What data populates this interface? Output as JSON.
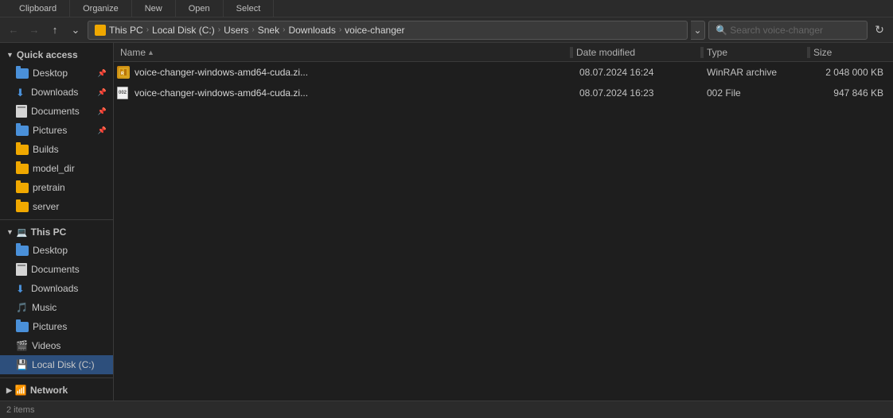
{
  "toolbar": {
    "sections": [
      "Clipboard",
      "Organize",
      "New",
      "Open",
      "Select"
    ]
  },
  "addressbar": {
    "breadcrumbs": [
      {
        "label": "This PC",
        "icon": "pc"
      },
      {
        "label": "Local Disk (C:)"
      },
      {
        "label": "Users"
      },
      {
        "label": "Snek"
      },
      {
        "label": "Downloads"
      },
      {
        "label": "voice-changer"
      }
    ],
    "search_placeholder": "Search voice-changer"
  },
  "columns": {
    "name": "Name",
    "date": "Date modified",
    "type": "Type",
    "size": "Size"
  },
  "sidebar": {
    "sections": [
      {
        "header": "Quick access",
        "items": [
          {
            "label": "Desktop",
            "icon": "folder-blue",
            "pinned": true
          },
          {
            "label": "Downloads",
            "icon": "down-arrow",
            "pinned": true
          },
          {
            "label": "Documents",
            "icon": "documents",
            "pinned": true
          },
          {
            "label": "Pictures",
            "icon": "folder-blue",
            "pinned": true
          },
          {
            "label": "Builds",
            "icon": "folder-yellow"
          },
          {
            "label": "model_dir",
            "icon": "folder-yellow"
          },
          {
            "label": "pretrain",
            "icon": "folder-yellow"
          },
          {
            "label": "server",
            "icon": "folder-yellow"
          }
        ]
      },
      {
        "header": "This PC",
        "items": [
          {
            "label": "Desktop",
            "icon": "folder-blue"
          },
          {
            "label": "Documents",
            "icon": "documents"
          },
          {
            "label": "Downloads",
            "icon": "down-arrow"
          },
          {
            "label": "Music",
            "icon": "music"
          },
          {
            "label": "Pictures",
            "icon": "folder-blue"
          },
          {
            "label": "Videos",
            "icon": "videos"
          },
          {
            "label": "Local Disk (C:)",
            "icon": "hdd",
            "active": true
          }
        ]
      },
      {
        "header": "Network",
        "items": []
      }
    ]
  },
  "files": [
    {
      "name": "voice-changer-windows-amd64-cuda.zi...",
      "date": "08.07.2024 16:24",
      "type": "WinRAR archive",
      "size": "2 048 000 KB",
      "icon": "winrar"
    },
    {
      "name": "voice-changer-windows-amd64-cuda.zi...",
      "date": "08.07.2024 16:23",
      "type": "002 File",
      "size": "947 846 KB",
      "icon": "file002"
    }
  ]
}
